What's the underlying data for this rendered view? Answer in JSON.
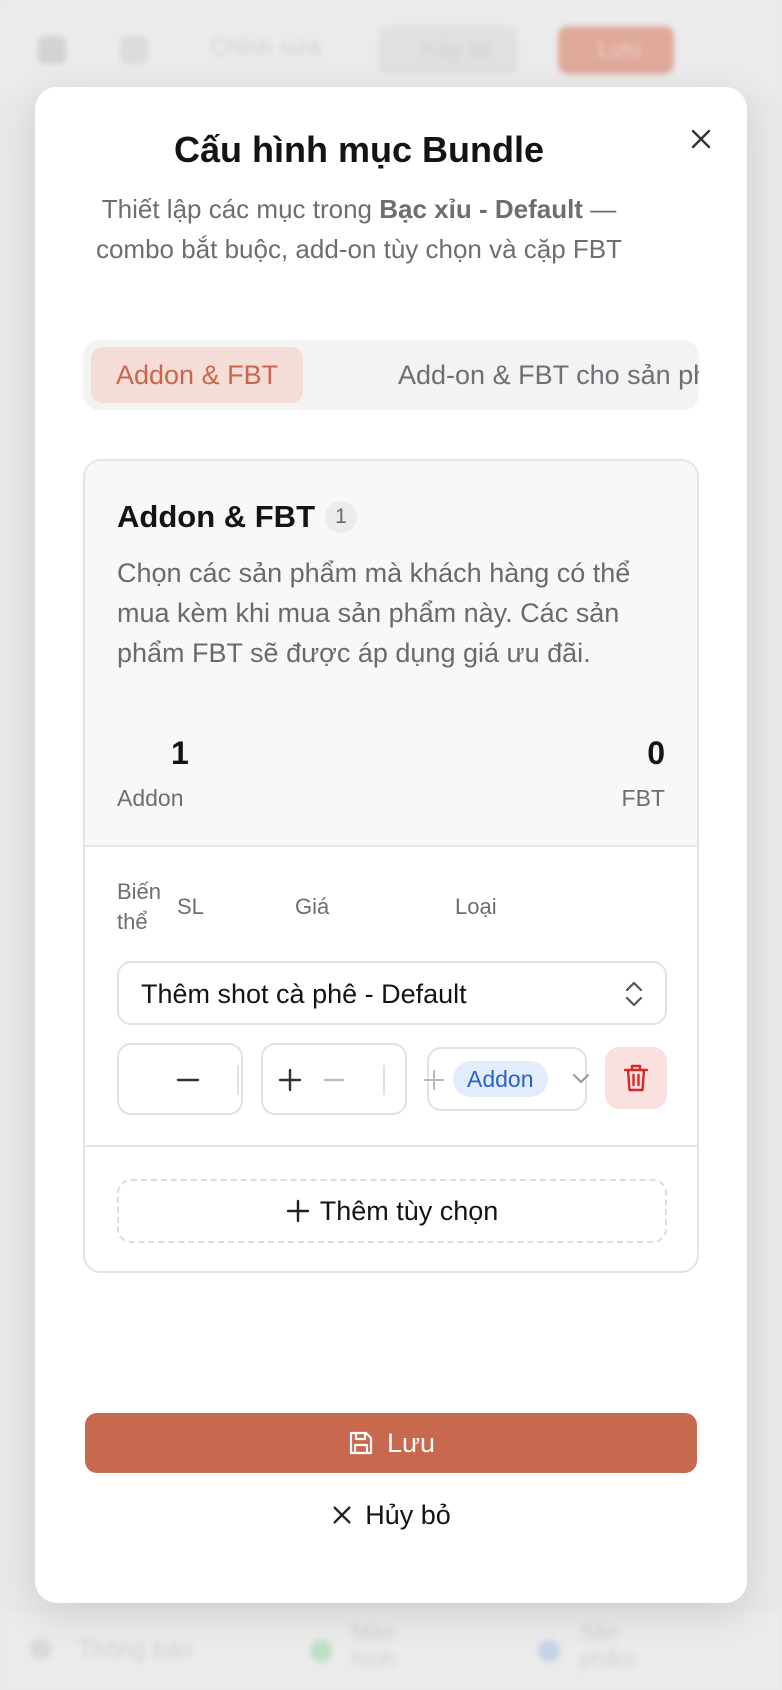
{
  "background": {
    "toolbar_labels": [
      "Chỉnh sửa",
      "Xây lại",
      "Lưu"
    ],
    "bottom_labels": [
      "Thông báo",
      "Màn hình",
      "Sản phẩm"
    ]
  },
  "modal": {
    "title": "Cấu hình mục Bundle",
    "subtitle_prefix": "Thiết lập các mục trong ",
    "subtitle_strong": "Bạc xỉu - Default",
    "subtitle_suffix": " — combo bắt buộc, add-on tùy chọn và cặp FBT",
    "tabs": [
      {
        "label": "Addon & FBT",
        "active": true
      },
      {
        "label": "Add-on & FBT cho sản phẩm",
        "active": false
      }
    ],
    "section": {
      "title": "Addon & FBT",
      "count": "1",
      "description": "Chọn các sản phẩm mà khách hàng có thể mua kèm khi mua sản phẩm này. Các sản phẩm FBT sẽ được áp dụng giá ưu đãi.",
      "stats": [
        {
          "value": "1",
          "label": "Addon"
        },
        {
          "value": "0",
          "label": "FBT"
        }
      ],
      "columns": {
        "variant": "Biến thể",
        "qty": "SL",
        "price": "Giá",
        "type": "Loại"
      },
      "row": {
        "variant": "Thêm shot cà phê - Default",
        "type_badge": "Addon"
      },
      "add_option_label": "Thêm tùy chọn"
    },
    "save_label": "Lưu",
    "cancel_label": "Hủy bỏ"
  },
  "colors": {
    "accent": "#c8684e",
    "tab_active_bg": "#f4ddd6",
    "badge_blue": "#2a62c9",
    "danger": "#d42a2a"
  }
}
